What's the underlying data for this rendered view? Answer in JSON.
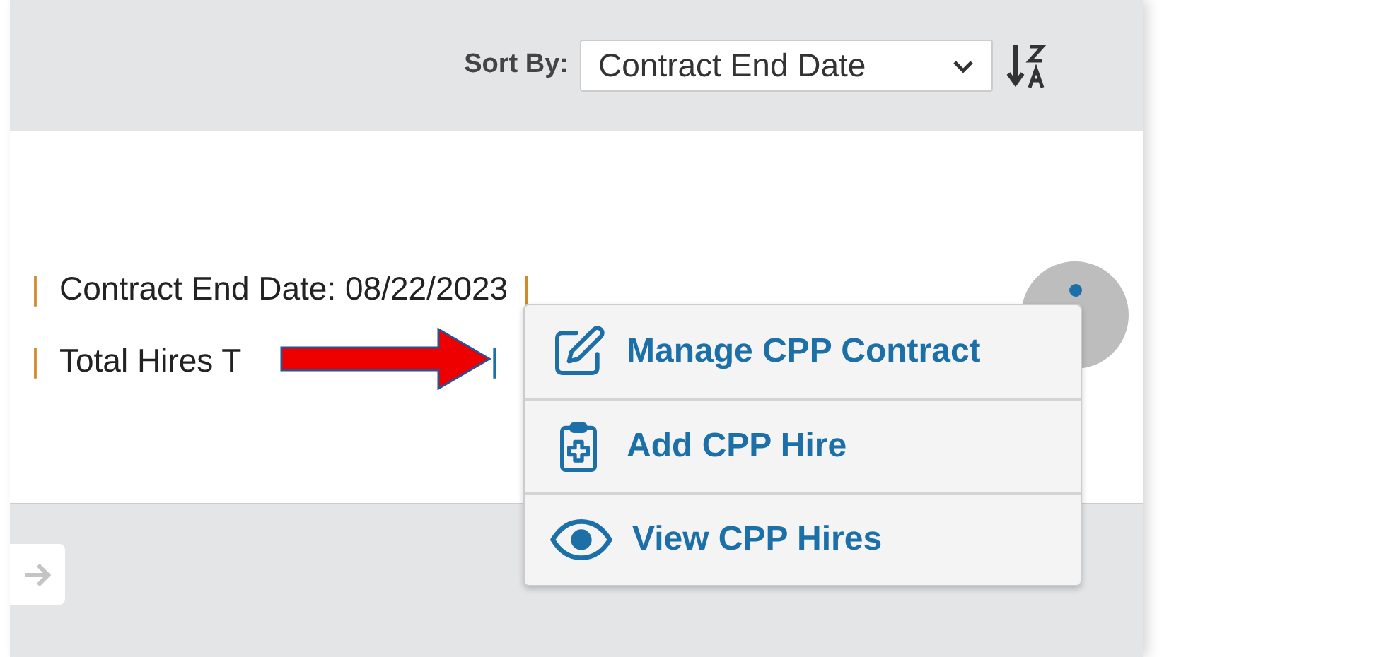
{
  "sort": {
    "label": "Sort By:",
    "value": "Contract End Date"
  },
  "rows": [
    {
      "separator_left": "|",
      "text": "Contract End Date: 08/22/2023",
      "separator_right": "|"
    },
    {
      "separator_left": "|",
      "text": "Total Hires T",
      "separator_right": "|"
    }
  ],
  "actions_menu": {
    "items": [
      {
        "kind": "edit",
        "label": "Manage CPP Contract"
      },
      {
        "kind": "add",
        "label": "Add CPP Hire"
      },
      {
        "kind": "view",
        "label": "View CPP Hires"
      }
    ]
  }
}
